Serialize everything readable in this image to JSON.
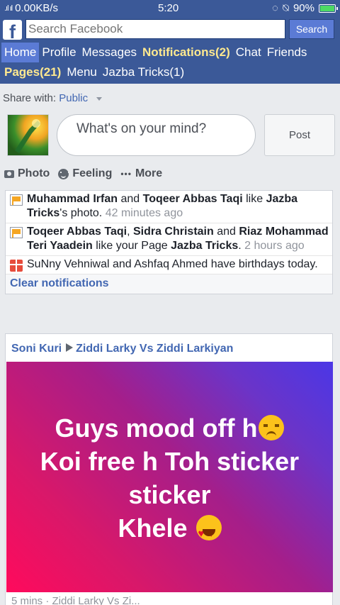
{
  "status_bar": {
    "network": "0.00KB/s",
    "time": "5:20",
    "battery": "90%",
    "battery_level": 0.9
  },
  "header": {
    "search_placeholder": "Search Facebook",
    "search_button": "Search",
    "nav": [
      "Home",
      "Profile",
      "Messages",
      "Notifications(2)",
      "Chat",
      "Friends",
      "Pages(21)",
      "Menu",
      "Jazba Tricks(1)"
    ]
  },
  "composer": {
    "share_with_label": "Share with:",
    "audience": "Public",
    "placeholder": "What's on your mind?",
    "post_button": "Post",
    "actions": {
      "photo": "Photo",
      "feeling": "Feeling",
      "more": "More"
    }
  },
  "notifications": {
    "items": [
      {
        "segments": [
          {
            "text": "Muhammad Irfan",
            "bold": true
          },
          {
            "text": " and ",
            "bold": false
          },
          {
            "text": "Toqeer Abbas Taqi",
            "bold": true
          },
          {
            "text": " like ",
            "bold": false
          },
          {
            "text": "Jazba Tricks",
            "bold": true
          },
          {
            "text": "'s photo. ",
            "bold": false
          }
        ],
        "time": "42 minutes ago"
      },
      {
        "segments": [
          {
            "text": "Toqeer Abbas Taqi",
            "bold": true
          },
          {
            "text": ", ",
            "bold": false
          },
          {
            "text": "Sidra Christain",
            "bold": true
          },
          {
            "text": " and ",
            "bold": false
          },
          {
            "text": "Riaz Mohammad Teri Yaadein",
            "bold": true
          },
          {
            "text": " like your Page ",
            "bold": false
          },
          {
            "text": "Jazba Tricks",
            "bold": true
          },
          {
            "text": ". ",
            "bold": false
          }
        ],
        "time": "2 hours ago"
      },
      {
        "text": "SuNny Vehniwal and Ashfaq Ahmed have birthdays today."
      }
    ],
    "clear_label": "Clear notifications"
  },
  "post": {
    "author": "Soni Kuri",
    "target": "Ziddi Larky Vs Ziddi Larkiyan",
    "lines": [
      "Guys mood off h",
      "Koi free h Toh sticker",
      "sticker",
      "Khele"
    ],
    "footer": "5 mins · Ziddi Larky Vs Zi..."
  },
  "colors": {
    "brand": "#3b5998",
    "link": "#4267b2",
    "nav_highlight": "#ffe98f"
  }
}
